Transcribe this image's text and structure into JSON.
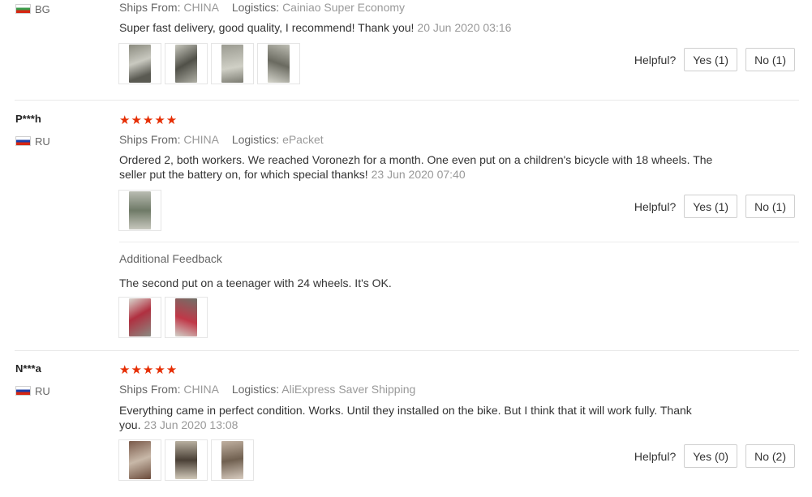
{
  "labels": {
    "ships_from": "Ships From:",
    "logistics": "Logistics:",
    "helpful": "Helpful?",
    "additional_feedback": "Additional Feedback"
  },
  "stars": "★★★★★",
  "reviews": [
    {
      "user": "",
      "country": "BG",
      "ships_from": "CHINA",
      "logistics": "Cainiao Super Economy",
      "text": "Super fast delivery, good quality, I recommend! Thank you!",
      "date": "20 Jun 2020 03:16",
      "yes": "Yes (1)",
      "no": "No (1)"
    },
    {
      "user": "P***h",
      "country": "RU",
      "ships_from": "CHINA",
      "logistics": "ePacket",
      "text": "Ordered 2, both workers. We reached Voronezh for a month. One even put on a children's bicycle with 18 wheels. The seller put the battery on, for which special thanks!",
      "date": "23 Jun 2020 07:40",
      "yes": "Yes (1)",
      "no": "No (1)",
      "additional_text": "The second put on a teenager with 24 wheels. It's OK."
    },
    {
      "user": "N***a",
      "country": "RU",
      "ships_from": "CHINA",
      "logistics": "AliExpress Saver Shipping",
      "text": "Everything came in perfect condition. Works. Until they installed on the bike. But I think that it will work fully. Thank you.",
      "date": "23 Jun 2020 13:08",
      "yes": "Yes (0)",
      "no": "No (2)"
    }
  ],
  "colors": {
    "star": "#e62e04",
    "muted": "#999999",
    "border": "#e8e8e8"
  }
}
